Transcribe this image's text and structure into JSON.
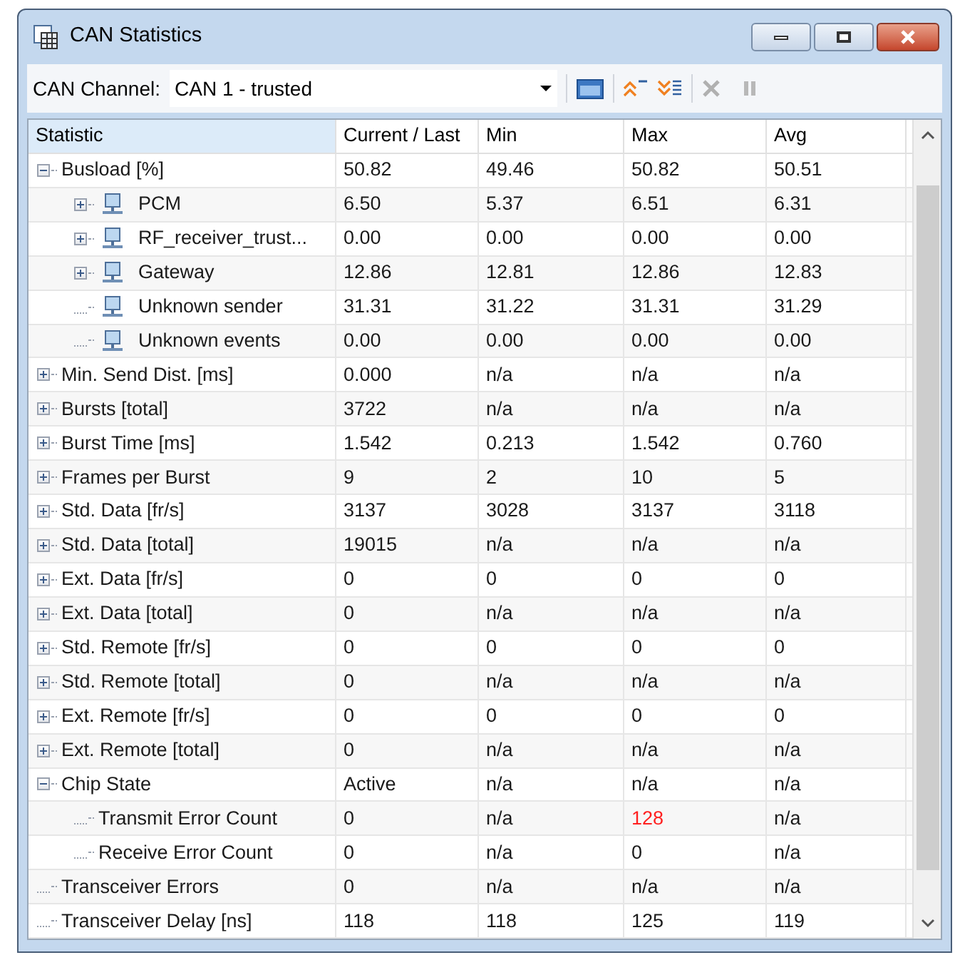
{
  "window": {
    "title": "CAN Statistics"
  },
  "toolbar": {
    "channel_label": "CAN Channel:",
    "channel_value": "CAN 1 - trusted"
  },
  "columns": [
    {
      "label": "Statistic",
      "selected": true
    },
    {
      "label": "Current / Last",
      "selected": false
    },
    {
      "label": "Min",
      "selected": false
    },
    {
      "label": "Max",
      "selected": false
    },
    {
      "label": "Avg",
      "selected": false
    }
  ],
  "rows": [
    {
      "kind": "stat",
      "name": "Busload [%]",
      "current": "50.82",
      "min": "49.46",
      "max": "50.82",
      "avg": "50.51",
      "max_alert": false,
      "expanded": true,
      "children": [
        {
          "kind": "node",
          "name": "PCM",
          "current": "6.50",
          "min": "5.37",
          "max": "6.51",
          "avg": "6.31",
          "max_alert": false,
          "expanded": false
        },
        {
          "kind": "node",
          "name": "RF_receiver_trust...",
          "current": "0.00",
          "min": "0.00",
          "max": "0.00",
          "avg": "0.00",
          "max_alert": false,
          "expanded": false
        },
        {
          "kind": "node",
          "name": "Gateway",
          "current": "12.86",
          "min": "12.81",
          "max": "12.86",
          "avg": "12.83",
          "max_alert": false,
          "expanded": false
        },
        {
          "kind": "node",
          "name": "Unknown sender",
          "current": "31.31",
          "min": "31.22",
          "max": "31.31",
          "avg": "31.29",
          "max_alert": false
        },
        {
          "kind": "node",
          "name": "Unknown events",
          "current": "0.00",
          "min": "0.00",
          "max": "0.00",
          "avg": "0.00",
          "max_alert": false
        }
      ]
    },
    {
      "kind": "stat",
      "name": "Min. Send Dist. [ms]",
      "current": "0.000",
      "min": "n/a",
      "max": "n/a",
      "avg": "n/a",
      "max_alert": false,
      "expanded": false
    },
    {
      "kind": "stat",
      "name": "Bursts [total]",
      "current": "3722",
      "min": "n/a",
      "max": "n/a",
      "avg": "n/a",
      "max_alert": false,
      "expanded": false
    },
    {
      "kind": "stat",
      "name": "Burst Time [ms]",
      "current": "1.542",
      "min": "0.213",
      "max": "1.542",
      "avg": "0.760",
      "max_alert": false,
      "expanded": false
    },
    {
      "kind": "stat",
      "name": "Frames per Burst",
      "current": "9",
      "min": "2",
      "max": "10",
      "avg": "5",
      "max_alert": false,
      "expanded": false
    },
    {
      "kind": "stat",
      "name": "Std. Data [fr/s]",
      "current": "3137",
      "min": "3028",
      "max": "3137",
      "avg": "3118",
      "max_alert": false,
      "expanded": false
    },
    {
      "kind": "stat",
      "name": "Std. Data [total]",
      "current": "19015",
      "min": "n/a",
      "max": "n/a",
      "avg": "n/a",
      "max_alert": false,
      "expanded": false
    },
    {
      "kind": "stat",
      "name": "Ext. Data [fr/s]",
      "current": "0",
      "min": "0",
      "max": "0",
      "avg": "0",
      "max_alert": false,
      "expanded": false
    },
    {
      "kind": "stat",
      "name": "Ext. Data [total]",
      "current": "0",
      "min": "n/a",
      "max": "n/a",
      "avg": "n/a",
      "max_alert": false,
      "expanded": false
    },
    {
      "kind": "stat",
      "name": "Std. Remote [fr/s]",
      "current": "0",
      "min": "0",
      "max": "0",
      "avg": "0",
      "max_alert": false,
      "expanded": false
    },
    {
      "kind": "stat",
      "name": "Std. Remote [total]",
      "current": "0",
      "min": "n/a",
      "max": "n/a",
      "avg": "n/a",
      "max_alert": false,
      "expanded": false
    },
    {
      "kind": "stat",
      "name": "Ext. Remote [fr/s]",
      "current": "0",
      "min": "0",
      "max": "0",
      "avg": "0",
      "max_alert": false,
      "expanded": false
    },
    {
      "kind": "stat",
      "name": "Ext. Remote [total]",
      "current": "0",
      "min": "n/a",
      "max": "n/a",
      "avg": "n/a",
      "max_alert": false,
      "expanded": false
    },
    {
      "kind": "stat",
      "name": "Chip State",
      "current": "Active",
      "min": "n/a",
      "max": "n/a",
      "avg": "n/a",
      "max_alert": false,
      "expanded": true,
      "children": [
        {
          "kind": "stat",
          "name": "Transmit Error Count",
          "current": "0",
          "min": "n/a",
          "max": "128",
          "avg": "n/a",
          "max_alert": true
        },
        {
          "kind": "stat",
          "name": "Receive Error Count",
          "current": "0",
          "min": "n/a",
          "max": "0",
          "avg": "n/a",
          "max_alert": false
        }
      ]
    },
    {
      "kind": "stat",
      "name": "Transceiver Errors",
      "current": "0",
      "min": "n/a",
      "max": "n/a",
      "avg": "n/a",
      "max_alert": false
    },
    {
      "kind": "stat",
      "name": "Transceiver Delay [ns]",
      "current": "118",
      "min": "118",
      "max": "125",
      "avg": "119",
      "max_alert": false
    }
  ]
}
